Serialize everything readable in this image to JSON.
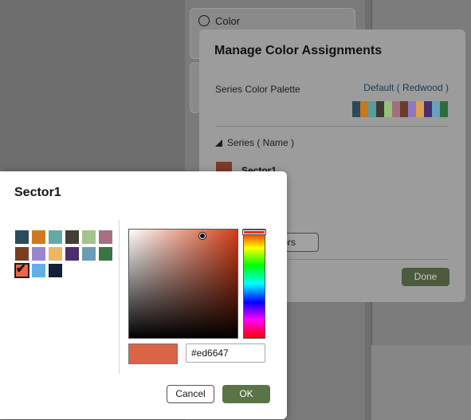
{
  "background": {
    "color_card_label": "Color",
    "palette_icon": "palette-icon"
  },
  "manage_dialog": {
    "title": "Manage Color Assignments",
    "palette_label": "Series Color Palette",
    "palette_value": "Default ( Redwood )",
    "palette_colors": [
      "#2e4a5a",
      "#c47822",
      "#5a9c9a",
      "#3c3a36",
      "#98c07a",
      "#a07080",
      "#6a3a2a",
      "#8c7ac0",
      "#d8a450",
      "#4a3070",
      "#6aa0c0",
      "#2e6a3a"
    ],
    "series_header": "Series ( Name )",
    "series_name": "Sector1",
    "series_color": "#7a3a2a",
    "reset_label": "olors",
    "done_label": "Done"
  },
  "picker": {
    "title": "Sector1",
    "swatches": [
      {
        "color": "#2b4c5c",
        "selected": false
      },
      {
        "color": "#cf7a22",
        "selected": false
      },
      {
        "color": "#63a9a6",
        "selected": false
      },
      {
        "color": "#433d36",
        "selected": false
      },
      {
        "color": "#a1c58c",
        "selected": false
      },
      {
        "color": "#a86f82",
        "selected": false
      },
      {
        "color": "#7a3e20",
        "selected": false
      },
      {
        "color": "#9986d1",
        "selected": false
      },
      {
        "color": "#ecb763",
        "selected": false
      },
      {
        "color": "#4d2d6b",
        "selected": false
      },
      {
        "color": "#6a9bb9",
        "selected": false
      },
      {
        "color": "#3a7444",
        "selected": false
      },
      {
        "color": "#ed6647",
        "selected": true
      },
      {
        "color": "#62b0e8",
        "selected": false
      },
      {
        "color": "#102137",
        "selected": false
      }
    ],
    "hex_value": "#ed6647",
    "preview_color": "#d96446",
    "cancel_label": "Cancel",
    "ok_label": "OK"
  }
}
